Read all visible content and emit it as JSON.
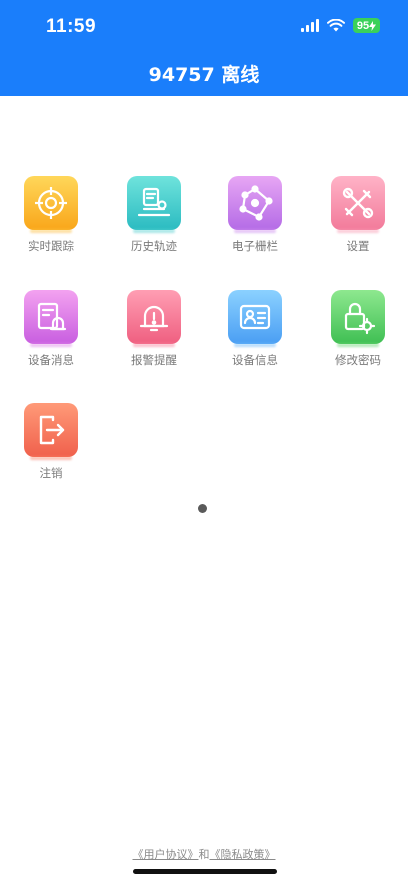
{
  "status": {
    "time": "11:59",
    "battery": "95"
  },
  "header": {
    "title": "94757 离线"
  },
  "menu": [
    {
      "label": "实时跟踪",
      "icon": "target-icon",
      "color_top": "#ffd75a",
      "color_bottom": "#f9a61a"
    },
    {
      "label": "历史轨迹",
      "icon": "route-icon",
      "color_top": "#6fe3dc",
      "color_bottom": "#2bbbc1"
    },
    {
      "label": "电子栅栏",
      "icon": "geofence-icon",
      "color_top": "#e7a6f4",
      "color_bottom": "#b46be6"
    },
    {
      "label": "设置",
      "icon": "tools-icon",
      "color_top": "#ffb3c7",
      "color_bottom": "#f27a9a"
    },
    {
      "label": "设备消息",
      "icon": "message-bell-icon",
      "color_top": "#f3a2f0",
      "color_bottom": "#c85ee0"
    },
    {
      "label": "报警提醒",
      "icon": "alarm-bell-icon",
      "color_top": "#ff9eb3",
      "color_bottom": "#ef5f80"
    },
    {
      "label": "设备信息",
      "icon": "id-card-icon",
      "color_top": "#8bd1ff",
      "color_bottom": "#4a9ef3"
    },
    {
      "label": "修改密码",
      "icon": "lock-gear-icon",
      "color_top": "#8ee88f",
      "color_bottom": "#3fbf53"
    },
    {
      "label": "注销",
      "icon": "logout-icon",
      "color_top": "#ff9a78",
      "color_bottom": "#f0604c"
    }
  ],
  "footer": {
    "user_agreement": "《用户协议》",
    "and": "和",
    "privacy_policy": "《隐私政策》"
  }
}
